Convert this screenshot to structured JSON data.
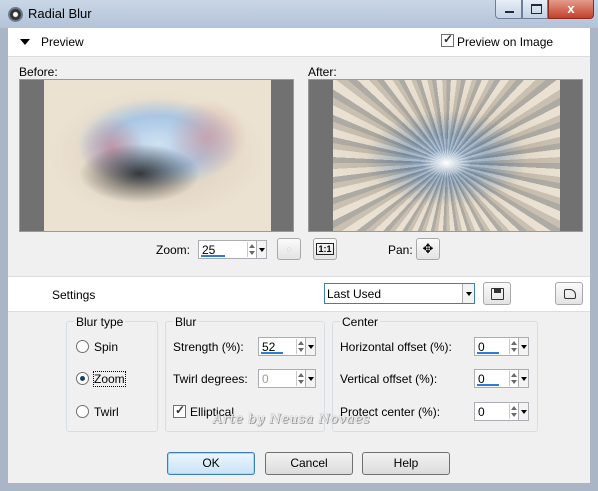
{
  "window": {
    "title": "Radial Blur",
    "icon": "camera-lens-icon",
    "controls": [
      "minimize-icon",
      "maximize-icon",
      "close-icon"
    ],
    "close_glyph": "x"
  },
  "preview_section": {
    "header_label": "Preview",
    "preview_on_image": {
      "label": "Preview on Image",
      "checked": true
    },
    "before_label": "Before:",
    "after_label": "After:",
    "zoom_label": "Zoom:",
    "zoom_value": "25",
    "one_to_one_label": "1:1",
    "pan_label": "Pan:"
  },
  "settings_bar": {
    "label": "Settings",
    "preset_value": "Last Used"
  },
  "blur_type": {
    "title": "Blur type",
    "options": [
      {
        "label": "Spin",
        "selected": false
      },
      {
        "label": "Zoom",
        "selected": true
      },
      {
        "label": "Twirl",
        "selected": false
      }
    ]
  },
  "blur": {
    "title": "Blur",
    "strength_label": "Strength (%):",
    "strength_value": "52",
    "twirl_label": "Twirl degrees:",
    "twirl_value": "0",
    "elliptical": {
      "label": "Elliptical",
      "checked": true
    }
  },
  "center": {
    "title": "Center",
    "horizontal_label": "Horizontal offset (%):",
    "horizontal_value": "0",
    "vertical_label": "Vertical offset (%):",
    "vertical_value": "0",
    "protect_label": "Protect center (%):",
    "protect_value": "0"
  },
  "buttons": {
    "ok": "OK",
    "cancel": "Cancel",
    "help": "Help"
  },
  "watermark": "Arte by Neusa Novaes",
  "colors": {
    "accent": "#2d7cd8",
    "titlebar": "#b3c3d8",
    "close": "#c4412c"
  }
}
